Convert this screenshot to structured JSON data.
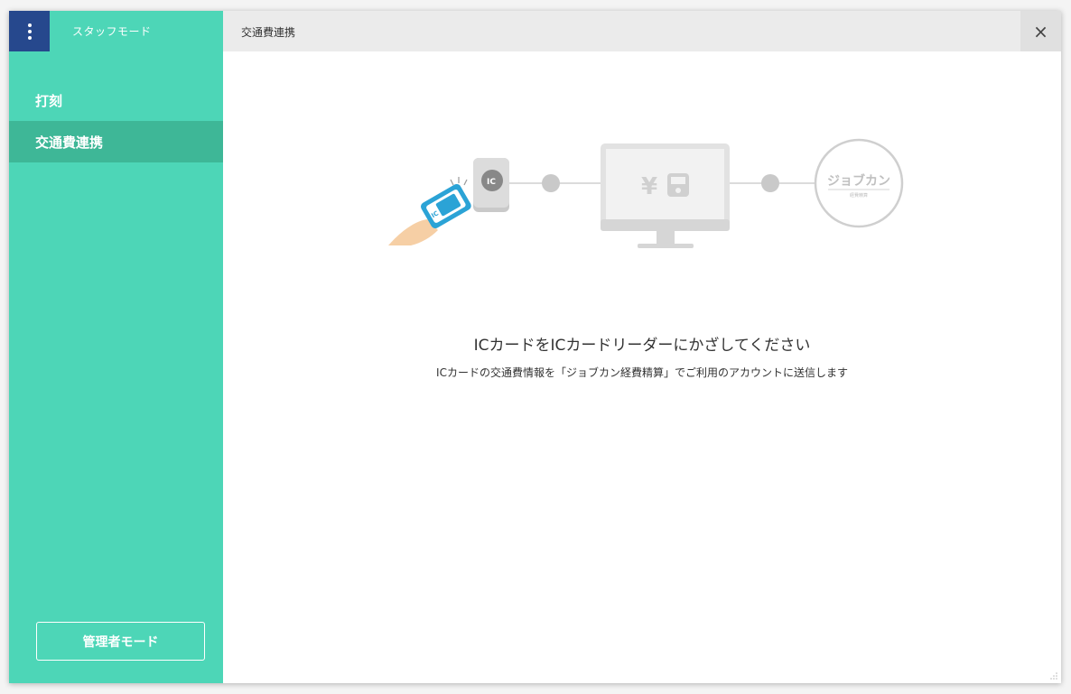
{
  "sidebar": {
    "mode_title": "スタッフモード",
    "items": [
      {
        "label": "打刻",
        "active": false
      },
      {
        "label": "交通費連携",
        "active": true
      }
    ],
    "admin_button": "管理者モード"
  },
  "header": {
    "title": "交通費連携",
    "close_icon": "×"
  },
  "main": {
    "illustration": {
      "ic_label": "IC",
      "monitor_yen": "¥",
      "logo_text": "ジョブカン",
      "logo_sub": "経費精算"
    },
    "message": "ICカードをICカードリーダーにかざしてください",
    "sub_message": "ICカードの交通費情報を「ジョブカン経費精算」でご利用のアカウントに送信します"
  },
  "colors": {
    "sidebar": "#4dd6b7",
    "sidebar_active": "#3eb797",
    "menu_button": "#26488d",
    "header": "#ebebeb",
    "illustration_gray": "#d0d0d0",
    "ic_card": "#2ba3d6"
  }
}
